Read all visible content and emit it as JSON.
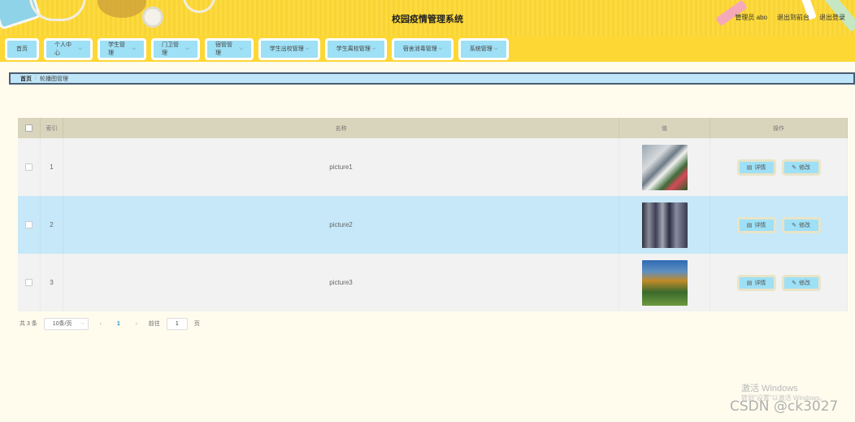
{
  "header": {
    "title": "校园疫情管理系统",
    "admin_label": "管理员 abo",
    "back_label": "退出到前台",
    "logout_label": "退出登录"
  },
  "menu": {
    "items": [
      {
        "label": "首页",
        "has_dropdown": false
      },
      {
        "label": "个人中心",
        "has_dropdown": true
      },
      {
        "label": "学生管理",
        "has_dropdown": true
      },
      {
        "label": "门卫管理",
        "has_dropdown": true
      },
      {
        "label": "宿管管理",
        "has_dropdown": true
      },
      {
        "label": "学生出校管理",
        "has_dropdown": true
      },
      {
        "label": "学生离校管理",
        "has_dropdown": true
      },
      {
        "label": "宿舍消毒管理",
        "has_dropdown": true
      },
      {
        "label": "系统管理",
        "has_dropdown": true
      }
    ]
  },
  "breadcrumb": {
    "home": "首页",
    "separator": "/",
    "current": "轮播图管理"
  },
  "table": {
    "headers": {
      "index": "索引",
      "name": "名称",
      "value": "值",
      "ops": "操作"
    },
    "rows": [
      {
        "index": "1",
        "name": "picture1"
      },
      {
        "index": "2",
        "name": "picture2"
      },
      {
        "index": "3",
        "name": "picture3"
      }
    ],
    "detail_label": "详情",
    "edit_label": "修改"
  },
  "pagination": {
    "total": "共 3 条",
    "page_size": "10条/页",
    "current_page": "1",
    "goto_label": "前往",
    "goto_value": "1",
    "page_unit": "页"
  },
  "watermark": {
    "activate_title": "激活 Windows",
    "activate_hint": "转到\"设置\"以激活 Windows。",
    "csdn": "CSDN @ck3027"
  },
  "colors": {
    "header_bg": "#fdd835",
    "menu_button": "#9ee0f5",
    "page_bg": "#fffcee",
    "row_highlight": "#c6e8f8",
    "table_header": "#d9d5bd"
  }
}
